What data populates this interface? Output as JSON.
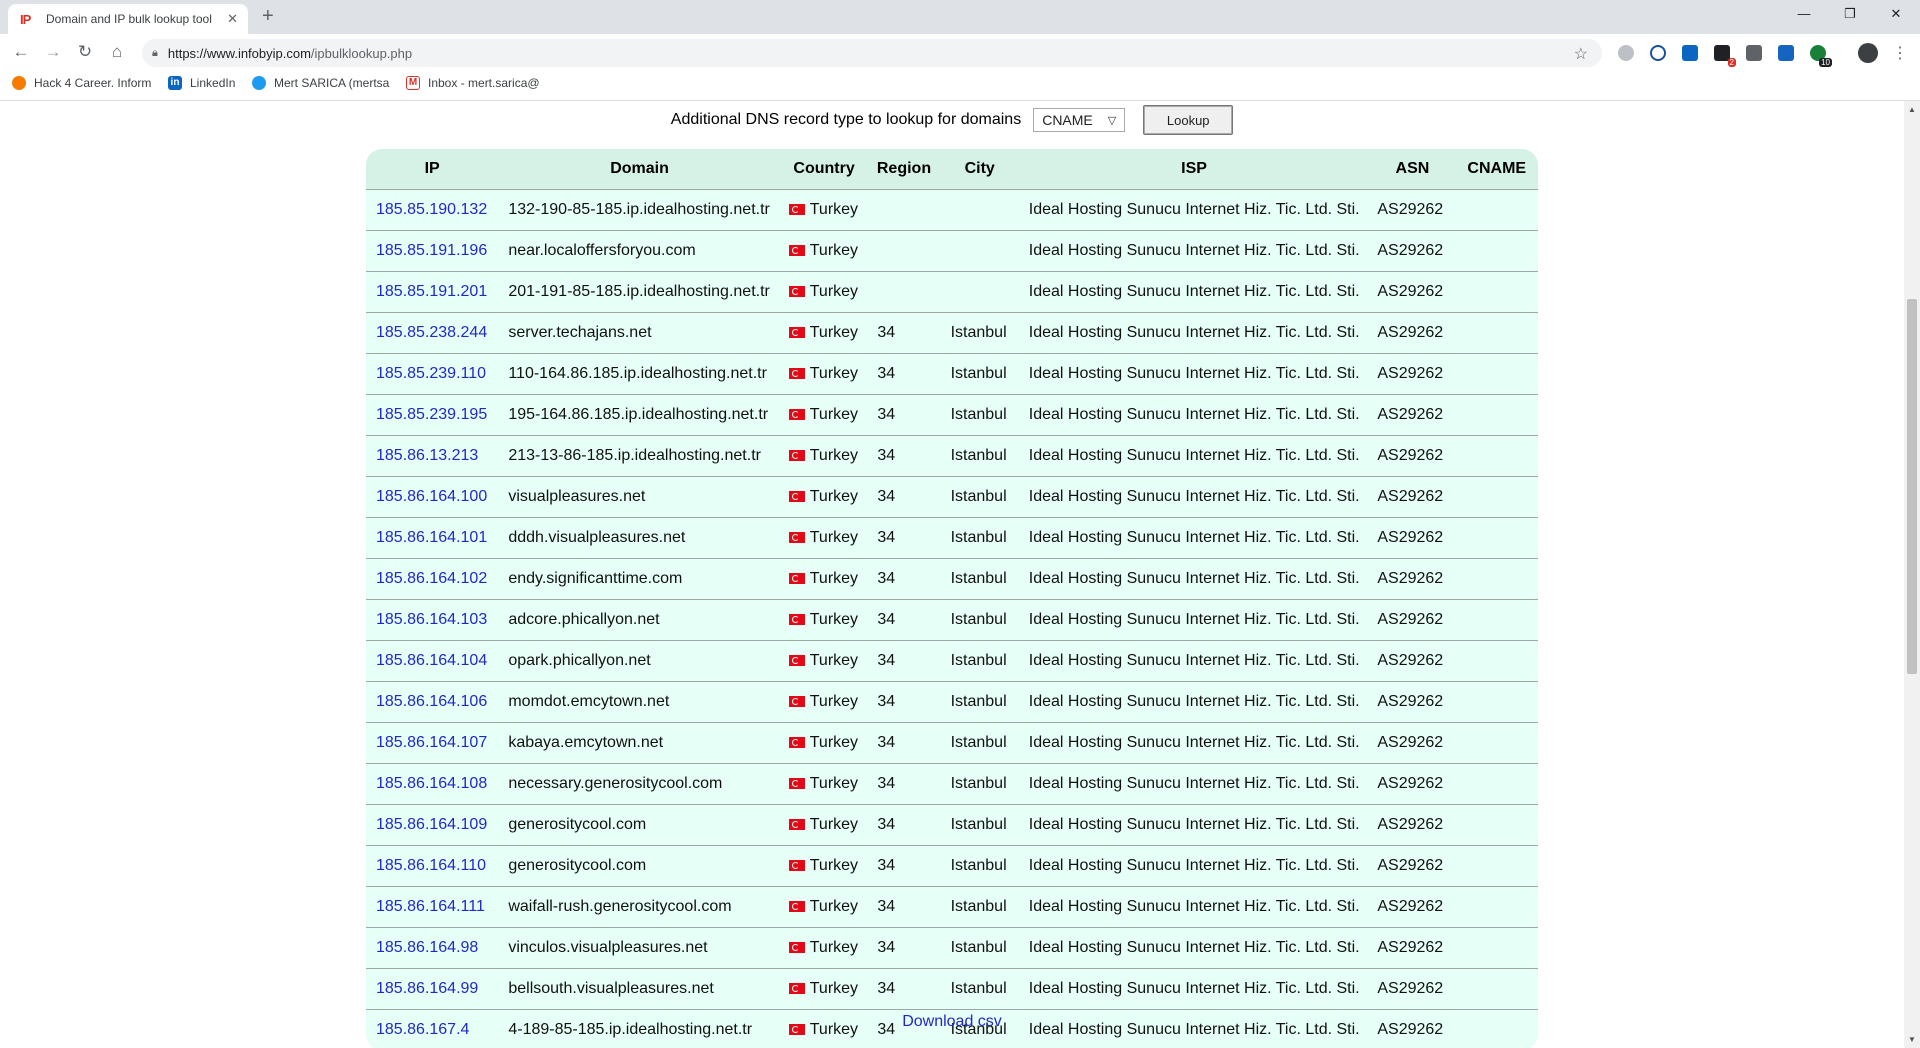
{
  "browser": {
    "tab_favicon": "IP",
    "tab_title": "Domain and IP bulk lookup tool",
    "url_host": "https://www.infobyip.com",
    "url_path": "/ipbulklookup.php",
    "bookmarks": [
      {
        "label": "Hack 4 Career. Inform",
        "color": "#f57c00"
      },
      {
        "label": "LinkedIn",
        "color": "#0a66c2"
      },
      {
        "label": "Mert SARICA (mertsa",
        "color": "#1d9bf0"
      },
      {
        "label": "Inbox - mert.sarica@",
        "color": "#d93025"
      }
    ],
    "extension_badges": [
      "2",
      "10"
    ]
  },
  "dns": {
    "label": "Additional DNS record type to lookup for domains",
    "selected": "CNAME",
    "button": "Lookup"
  },
  "table": {
    "headers": [
      "IP",
      "Domain",
      "Country",
      "Region",
      "City",
      "ISP",
      "ASN",
      "CNAME"
    ],
    "rows": [
      {
        "ip": "185.85.190.132",
        "domain": "132-190-85-185.ip.idealhosting.net.tr",
        "country": "Turkey",
        "region": "",
        "city": "",
        "isp": "Ideal Hosting Sunucu Internet Hiz. Tic. Ltd. Sti.",
        "asn": "AS29262",
        "cname": ""
      },
      {
        "ip": "185.85.191.196",
        "domain": "near.localoffersforyou.com",
        "country": "Turkey",
        "region": "",
        "city": "",
        "isp": "Ideal Hosting Sunucu Internet Hiz. Tic. Ltd. Sti.",
        "asn": "AS29262",
        "cname": ""
      },
      {
        "ip": "185.85.191.201",
        "domain": "201-191-85-185.ip.idealhosting.net.tr",
        "country": "Turkey",
        "region": "",
        "city": "",
        "isp": "Ideal Hosting Sunucu Internet Hiz. Tic. Ltd. Sti.",
        "asn": "AS29262",
        "cname": ""
      },
      {
        "ip": "185.85.238.244",
        "domain": "server.techajans.net",
        "country": "Turkey",
        "region": "34",
        "city": "Istanbul",
        "isp": "Ideal Hosting Sunucu Internet Hiz. Tic. Ltd. Sti.",
        "asn": "AS29262",
        "cname": ""
      },
      {
        "ip": "185.85.239.110",
        "domain": "110-164.86.185.ip.idealhosting.net.tr",
        "country": "Turkey",
        "region": "34",
        "city": "Istanbul",
        "isp": "Ideal Hosting Sunucu Internet Hiz. Tic. Ltd. Sti.",
        "asn": "AS29262",
        "cname": ""
      },
      {
        "ip": "185.85.239.195",
        "domain": "195-164.86.185.ip.idealhosting.net.tr",
        "country": "Turkey",
        "region": "34",
        "city": "Istanbul",
        "isp": "Ideal Hosting Sunucu Internet Hiz. Tic. Ltd. Sti.",
        "asn": "AS29262",
        "cname": ""
      },
      {
        "ip": "185.86.13.213",
        "domain": "213-13-86-185.ip.idealhosting.net.tr",
        "country": "Turkey",
        "region": "34",
        "city": "Istanbul",
        "isp": "Ideal Hosting Sunucu Internet Hiz. Tic. Ltd. Sti.",
        "asn": "AS29262",
        "cname": ""
      },
      {
        "ip": "185.86.164.100",
        "domain": "visualpleasures.net",
        "country": "Turkey",
        "region": "34",
        "city": "Istanbul",
        "isp": "Ideal Hosting Sunucu Internet Hiz. Tic. Ltd. Sti.",
        "asn": "AS29262",
        "cname": ""
      },
      {
        "ip": "185.86.164.101",
        "domain": "dddh.visualpleasures.net",
        "country": "Turkey",
        "region": "34",
        "city": "Istanbul",
        "isp": "Ideal Hosting Sunucu Internet Hiz. Tic. Ltd. Sti.",
        "asn": "AS29262",
        "cname": ""
      },
      {
        "ip": "185.86.164.102",
        "domain": "endy.significanttime.com",
        "country": "Turkey",
        "region": "34",
        "city": "Istanbul",
        "isp": "Ideal Hosting Sunucu Internet Hiz. Tic. Ltd. Sti.",
        "asn": "AS29262",
        "cname": ""
      },
      {
        "ip": "185.86.164.103",
        "domain": "adcore.phicallyon.net",
        "country": "Turkey",
        "region": "34",
        "city": "Istanbul",
        "isp": "Ideal Hosting Sunucu Internet Hiz. Tic. Ltd. Sti.",
        "asn": "AS29262",
        "cname": ""
      },
      {
        "ip": "185.86.164.104",
        "domain": "opark.phicallyon.net",
        "country": "Turkey",
        "region": "34",
        "city": "Istanbul",
        "isp": "Ideal Hosting Sunucu Internet Hiz. Tic. Ltd. Sti.",
        "asn": "AS29262",
        "cname": ""
      },
      {
        "ip": "185.86.164.106",
        "domain": "momdot.emcytown.net",
        "country": "Turkey",
        "region": "34",
        "city": "Istanbul",
        "isp": "Ideal Hosting Sunucu Internet Hiz. Tic. Ltd. Sti.",
        "asn": "AS29262",
        "cname": ""
      },
      {
        "ip": "185.86.164.107",
        "domain": "kabaya.emcytown.net",
        "country": "Turkey",
        "region": "34",
        "city": "Istanbul",
        "isp": "Ideal Hosting Sunucu Internet Hiz. Tic. Ltd. Sti.",
        "asn": "AS29262",
        "cname": ""
      },
      {
        "ip": "185.86.164.108",
        "domain": "necessary.generositycool.com",
        "country": "Turkey",
        "region": "34",
        "city": "Istanbul",
        "isp": "Ideal Hosting Sunucu Internet Hiz. Tic. Ltd. Sti.",
        "asn": "AS29262",
        "cname": ""
      },
      {
        "ip": "185.86.164.109",
        "domain": "generositycool.com",
        "country": "Turkey",
        "region": "34",
        "city": "Istanbul",
        "isp": "Ideal Hosting Sunucu Internet Hiz. Tic. Ltd. Sti.",
        "asn": "AS29262",
        "cname": ""
      },
      {
        "ip": "185.86.164.110",
        "domain": "generositycool.com",
        "country": "Turkey",
        "region": "34",
        "city": "Istanbul",
        "isp": "Ideal Hosting Sunucu Internet Hiz. Tic. Ltd. Sti.",
        "asn": "AS29262",
        "cname": ""
      },
      {
        "ip": "185.86.164.111",
        "domain": "waifall-rush.generositycool.com",
        "country": "Turkey",
        "region": "34",
        "city": "Istanbul",
        "isp": "Ideal Hosting Sunucu Internet Hiz. Tic. Ltd. Sti.",
        "asn": "AS29262",
        "cname": ""
      },
      {
        "ip": "185.86.164.98",
        "domain": "vinculos.visualpleasures.net",
        "country": "Turkey",
        "region": "34",
        "city": "Istanbul",
        "isp": "Ideal Hosting Sunucu Internet Hiz. Tic. Ltd. Sti.",
        "asn": "AS29262",
        "cname": ""
      },
      {
        "ip": "185.86.164.99",
        "domain": "bellsouth.visualpleasures.net",
        "country": "Turkey",
        "region": "34",
        "city": "Istanbul",
        "isp": "Ideal Hosting Sunucu Internet Hiz. Tic. Ltd. Sti.",
        "asn": "AS29262",
        "cname": ""
      },
      {
        "ip": "185.86.167.4",
        "domain": "4-189-85-185.ip.idealhosting.net.tr",
        "country": "Turkey",
        "region": "34",
        "city": "Istanbul",
        "isp": "Ideal Hosting Sunucu Internet Hiz. Tic. Ltd. Sti.",
        "asn": "AS29262",
        "cname": ""
      }
    ]
  },
  "download_label": "Download csv"
}
